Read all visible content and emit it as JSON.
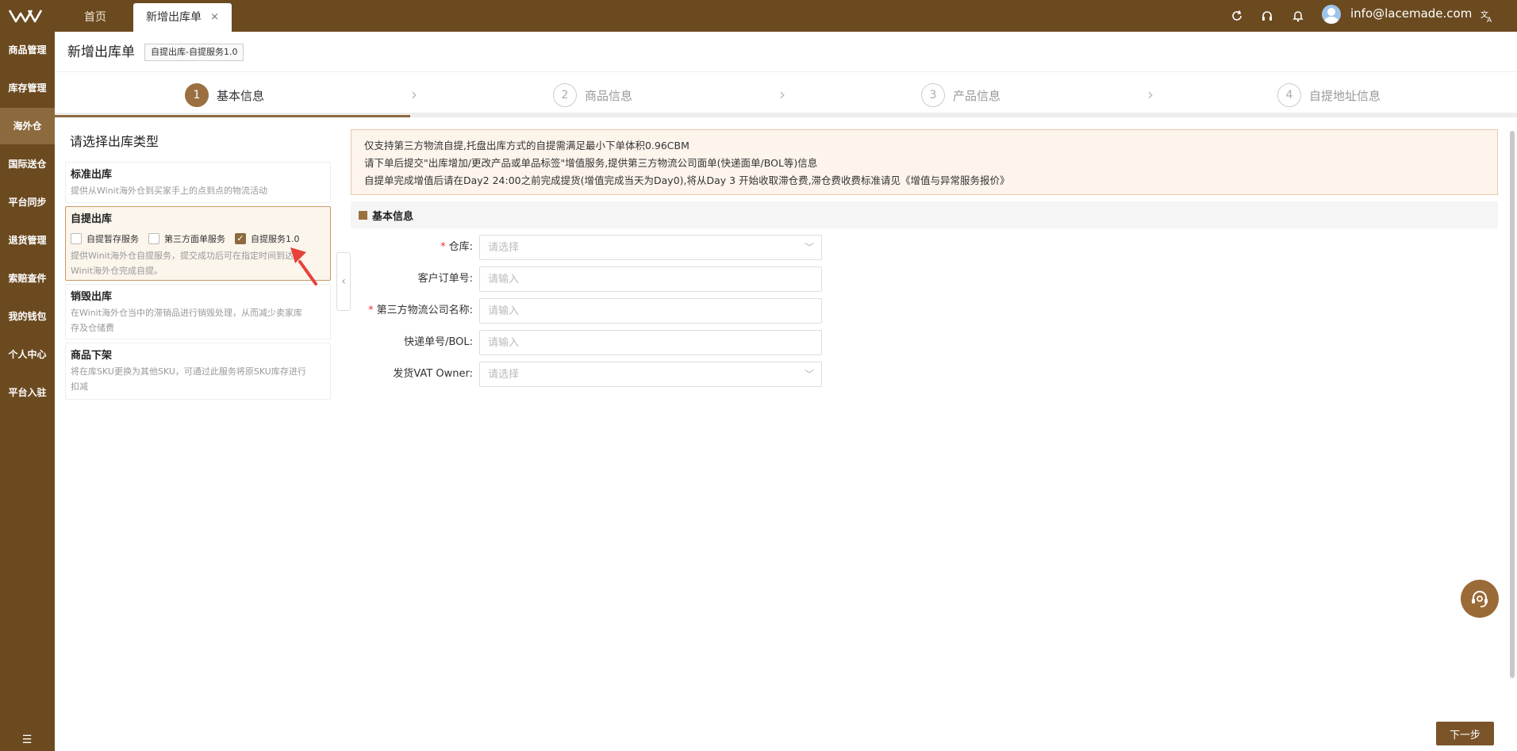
{
  "topbar": {
    "tabs": [
      {
        "label": "首页"
      },
      {
        "label": "新增出库单",
        "close": "×"
      }
    ],
    "icons": [
      "refresh-icon",
      "headset-icon",
      "bell-icon",
      "translate-icon"
    ],
    "user_email": "info@lacemade.com",
    "colors": {
      "bar": "#6b4a20",
      "accent": "#8c6a3d"
    }
  },
  "sidebar": {
    "items": [
      {
        "label": "商品管理"
      },
      {
        "label": "库存管理"
      },
      {
        "label": "海外仓",
        "active": true
      },
      {
        "label": "国际送仓"
      },
      {
        "label": "平台同步"
      },
      {
        "label": "退货管理"
      },
      {
        "label": "索赔查件"
      },
      {
        "label": "我的钱包"
      },
      {
        "label": "个人中心"
      },
      {
        "label": "平台入驻"
      }
    ]
  },
  "header": {
    "title": "新增出库单",
    "tag": "自提出库-自提服务1.0"
  },
  "steps": [
    {
      "num": "1",
      "label": "基本信息",
      "active": true
    },
    {
      "num": "2",
      "label": "商品信息"
    },
    {
      "num": "3",
      "label": "产品信息"
    },
    {
      "num": "4",
      "label": "自提地址信息"
    }
  ],
  "type_panel": {
    "title": "请选择出库类型",
    "cards": [
      {
        "title": "标准出库",
        "desc": "提供从Winit海外仓到买家手上的点到点的物流活动"
      },
      {
        "title": "自提出库",
        "options": [
          {
            "label": "自提暂存服务",
            "checked": false
          },
          {
            "label": "第三方面单服务",
            "checked": false
          },
          {
            "label": "自提服务1.0",
            "checked": true
          }
        ],
        "desc_line1": "提供Winit海外仓自提服务，提交成功后可在指定时间到达",
        "desc_line2": "Winit海外仓完成自提。"
      },
      {
        "title": "销毁出库",
        "desc_line1": "在Winit海外仓当中的滞销品进行销毁处理，从而减少卖家库",
        "desc_line2": "存及仓储费"
      },
      {
        "title": "商品下架",
        "desc_line1": "将在库SKU更换为其他SKU，可通过此服务将原SKU库存进行",
        "desc_line2": "扣减"
      }
    ]
  },
  "notice": {
    "lines": [
      "仅支持第三方物流自提,托盘出库方式的自提需满足最小下单体积0.96CBM",
      "请下单后提交\"出库增加/更改产品或单品标签\"增值服务,提供第三方物流公司面单(快递面单/BOL等)信息",
      "自提单完成增值后请在Day2 24:00之前完成提货(增值完成当天为Day0),将从Day 3 开始收取滞仓费,滞仓费收费标准请见《增值与异常服务报价》"
    ]
  },
  "form": {
    "section_title": "基本信息",
    "fields": [
      {
        "label": "仓库:",
        "required": true,
        "placeholder": "请选择",
        "type": "select"
      },
      {
        "label": "客户订单号:",
        "required": false,
        "placeholder": "请输入",
        "type": "text"
      },
      {
        "label": "第三方物流公司名称:",
        "required": true,
        "placeholder": "请输入",
        "type": "text"
      },
      {
        "label": "快递单号/BOL:",
        "required": false,
        "placeholder": "请输入",
        "type": "text"
      },
      {
        "label": "发货VAT Owner:",
        "required": false,
        "placeholder": "请选择",
        "type": "select"
      }
    ]
  },
  "footer": {
    "next_label": "下一步"
  }
}
